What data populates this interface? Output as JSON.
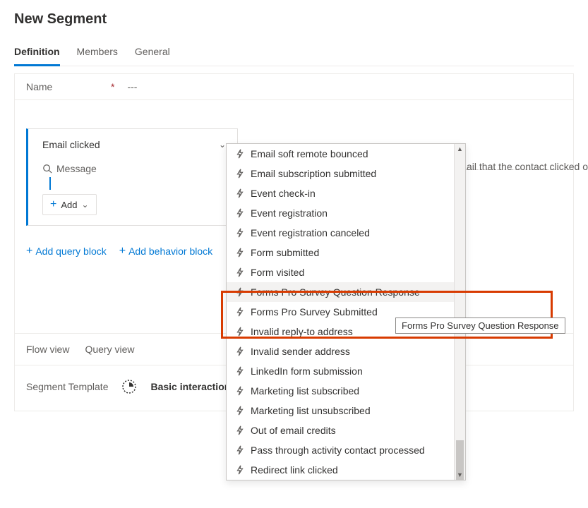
{
  "page_title": "New Segment",
  "tabs": {
    "definition": "Definition",
    "members": "Members",
    "general": "General"
  },
  "name_field": {
    "label": "Name",
    "value": "---"
  },
  "block": {
    "title": "Email clicked",
    "search_label": "Message",
    "add_label": "Add"
  },
  "hint_text": "ail that the contact clicked on",
  "actions": {
    "add_query": "Add query block",
    "add_behavior": "Add behavior block"
  },
  "footer": {
    "flow": "Flow view",
    "query": "Query view"
  },
  "template": {
    "label": "Segment Template",
    "name": "Basic interaction"
  },
  "dropdown": {
    "items": [
      "Email soft remote bounced",
      "Email subscription submitted",
      "Event check-in",
      "Event registration",
      "Event registration canceled",
      "Form submitted",
      "Form visited",
      "Forms Pro Survey Question Response",
      "Forms Pro Survey Submitted",
      "Invalid reply-to address",
      "Invalid sender address",
      "LinkedIn form submission",
      "Marketing list subscribed",
      "Marketing list unsubscribed",
      "Out of email credits",
      "Pass through activity contact processed",
      "Redirect link clicked"
    ],
    "hovered_index": 7
  },
  "tooltip_text": "Forms Pro Survey Question Response"
}
